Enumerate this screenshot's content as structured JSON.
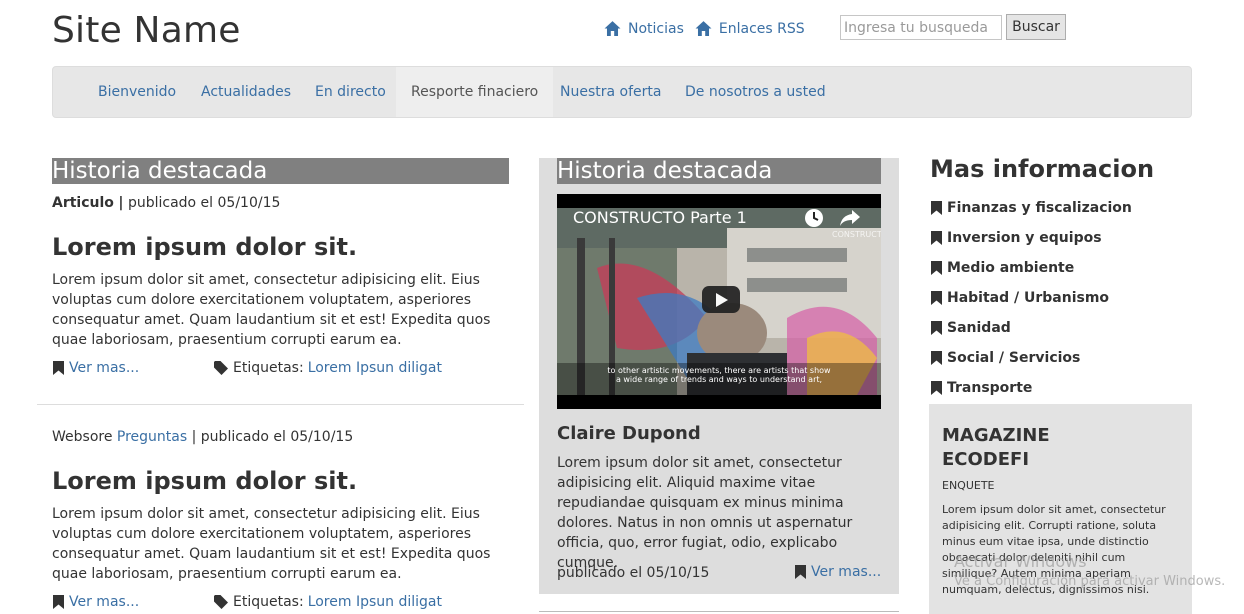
{
  "header": {
    "site_name": "Site Name",
    "links": [
      {
        "label": "Noticias",
        "icon": "home-icon"
      },
      {
        "label": "Enlaces RSS",
        "icon": "home-icon"
      }
    ],
    "search": {
      "placeholder": "Ingresa tu busqueda",
      "button_label": "Buscar"
    }
  },
  "nav": {
    "items": [
      {
        "label": "Bienvenido",
        "active": false
      },
      {
        "label": "Actualidades",
        "active": false
      },
      {
        "label": "En directo",
        "active": false
      },
      {
        "label": "Resporte finaciero",
        "active": true
      },
      {
        "label": "Nuestra oferta",
        "active": false
      },
      {
        "label": "De nosotros a usted",
        "active": false
      }
    ]
  },
  "left": {
    "heading": "Historia destacada",
    "articles": [
      {
        "meta_type": "Articulo",
        "meta_sep": "|",
        "meta_date": "publicado el 05/10/15",
        "title": "Lorem ipsum dolor sit.",
        "body": "Lorem ipsum dolor sit amet, consectetur adipisicing elit. Eius voluptas cum dolore exercitationem voluptatem, asperiores consequatur amet. Quam laudantium sit et est! Expedita quos quae laboriosam, praesentium corrupti earum ea.",
        "read_more": "Ver mas...",
        "tags_label": "Etiquetas:",
        "tags_value": "Lorem Ipsun diligat"
      },
      {
        "meta_prefix": "Websore",
        "meta_link": "Preguntas",
        "meta_sep": "|",
        "meta_date": "publicado el 05/10/15",
        "title": "Lorem ipsum dolor sit.",
        "body": "Lorem ipsum dolor sit amet, consectetur adipisicing elit. Eius voluptas cum dolore exercitationem voluptatem, asperiores consequatur amet. Quam laudantium sit et est! Expedita quos quae laboriosam, praesentium corrupti earum ea.",
        "read_more": "Ver mas...",
        "tags_label": "Etiquetas:",
        "tags_value": "Lorem Ipsun diligat"
      }
    ]
  },
  "center": {
    "heading": "Historia destacada",
    "video": {
      "title": "CONSTRUCTO Parte 1",
      "subtitles": [
        "to other artistic movements, there are artists that show",
        "a wide range of trends and ways to understand art,"
      ],
      "channel_badge": "CONSTRUCTO"
    },
    "author": "Claire Dupond",
    "body": "Lorem ipsum dolor sit amet, consectetur adipisicing elit. Aliquid maxime vitae repudiandae quisquam ex minus minima dolores. Natus in non omnis ut aspernatur officia, quo, error fugiat, odio, explicabo cumque.",
    "date": "publicado el 05/10/15",
    "read_more": "Ver mas..."
  },
  "right": {
    "heading": "Mas informacion",
    "items": [
      "Finanzas y fiscalizacion",
      "Inversion y equipos",
      "Medio ambiente",
      "Habitad / Urbanismo",
      "Sanidad",
      "Social / Servicios",
      "Transporte"
    ],
    "magazine": {
      "title": "MAGAZINE ECODEFI",
      "subtitle": "ENQUETE",
      "body": "Lorem ipsum dolor sit amet, consectetur adipisicing elit. Corrupti ratione, soluta minus eum vitae ipsa, unde distinctio obcaecati dolor deleniti nihil cum similique? Autem minima aperiam numquam, delectus, dignissimos nisi."
    }
  },
  "os_watermark": {
    "line1": "Activar Windows",
    "line2": "Ve a Configuración para activar Windows."
  },
  "colors": {
    "link": "#3a6fa4",
    "navbar_bg": "#e7e7e7",
    "heading_band": "#808080",
    "center_panel": "#dddddd",
    "magazine_panel": "#e3e3e3"
  }
}
